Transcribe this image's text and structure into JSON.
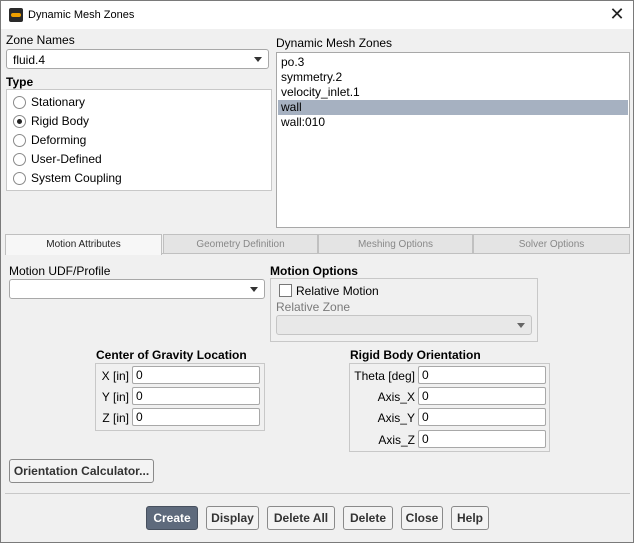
{
  "window": {
    "title": "Dynamic Mesh Zones",
    "close_glyph": "✕"
  },
  "zone_names": {
    "label": "Zone Names",
    "value": "fluid.4"
  },
  "type": {
    "label": "Type",
    "options": [
      "Stationary",
      "Rigid Body",
      "Deforming",
      "User-Defined",
      "System Coupling"
    ],
    "selected": "Rigid Body"
  },
  "dynamic_zones": {
    "label": "Dynamic Mesh Zones",
    "items": [
      "po.3",
      "symmetry.2",
      "velocity_inlet.1",
      "wall",
      "wall:010"
    ],
    "selected": "wall"
  },
  "tabs": [
    "Motion Attributes",
    "Geometry Definition",
    "Meshing Options",
    "Solver Options"
  ],
  "active_tab": "Motion Attributes",
  "motion_udf": {
    "label": "Motion UDF/Profile",
    "value": ""
  },
  "motion_options": {
    "label": "Motion Options",
    "relative_motion_label": "Relative Motion",
    "relative_motion_checked": false,
    "relative_zone_label": "Relative Zone",
    "relative_zone_value": ""
  },
  "cog": {
    "label": "Center of Gravity Location",
    "fields": [
      {
        "label": "X [in]",
        "value": "0"
      },
      {
        "label": "Y [in]",
        "value": "0"
      },
      {
        "label": "Z [in]",
        "value": "0"
      }
    ]
  },
  "orientation": {
    "label": "Rigid Body Orientation",
    "fields": [
      {
        "label": "Theta [deg]",
        "value": "0"
      },
      {
        "label": "Axis_X",
        "value": "0"
      },
      {
        "label": "Axis_Y",
        "value": "0"
      },
      {
        "label": "Axis_Z",
        "value": "0"
      }
    ]
  },
  "orientation_calculator_label": "Orientation Calculator...",
  "buttons": {
    "create": "Create",
    "display": "Display",
    "delete_all": "Delete All",
    "delete": "Delete",
    "close": "Close",
    "help": "Help"
  }
}
